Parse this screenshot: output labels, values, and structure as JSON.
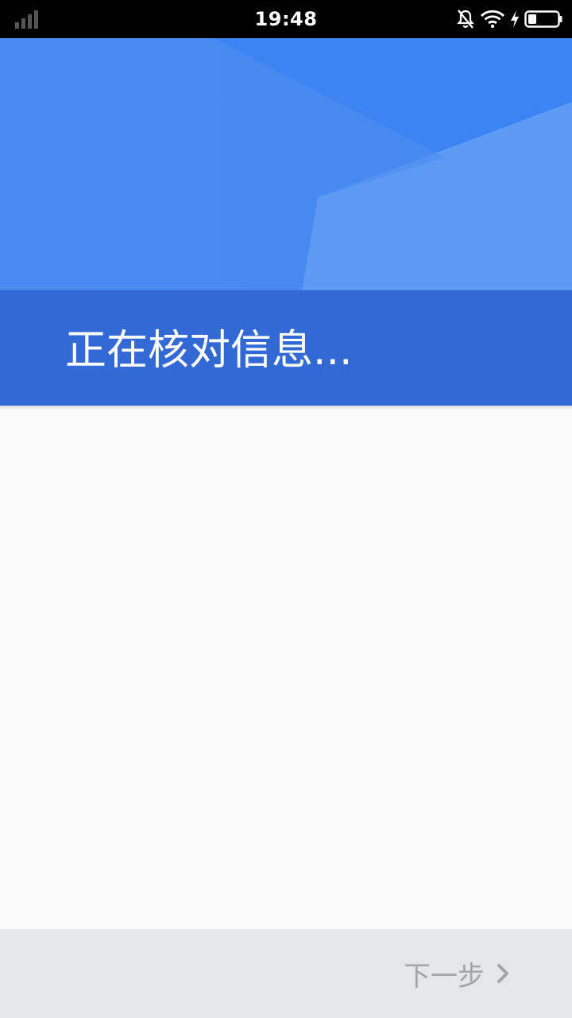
{
  "status_bar": {
    "time": "19:48",
    "icons": [
      "signal-icon",
      "mute-bell-icon",
      "wifi-icon",
      "charging-icon",
      "battery-icon"
    ]
  },
  "header": {
    "title": "正在核对信息..."
  },
  "footer": {
    "next_label": "下一步",
    "next_icon": "chevron-right-icon"
  },
  "colors": {
    "header_band": "#3269d6",
    "header_top": "#4a8af0",
    "background": "#fafafa",
    "bottom_bar": "#e4e7e8",
    "next_text": "#a3a6a8"
  }
}
